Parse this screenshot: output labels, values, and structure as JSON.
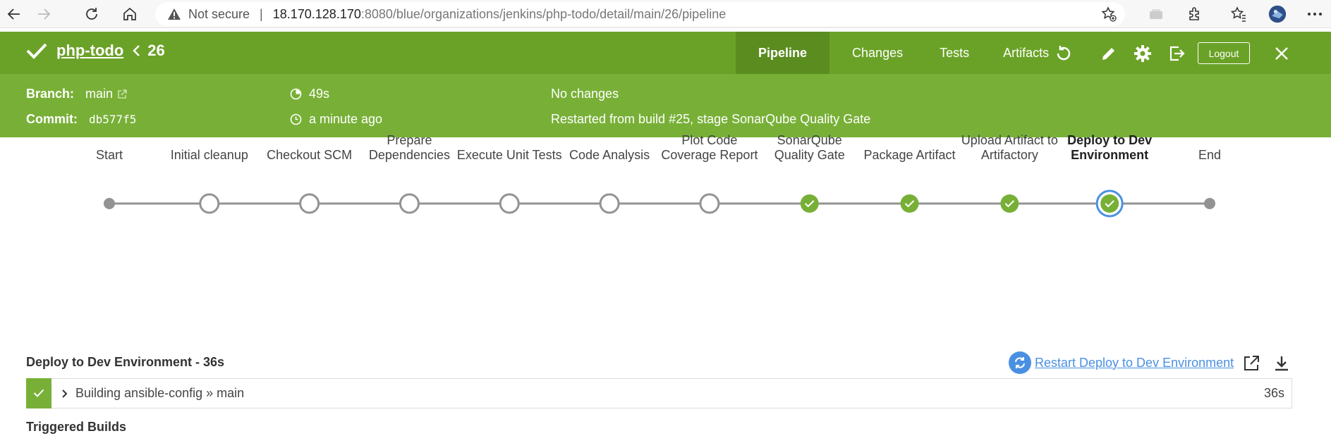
{
  "browser": {
    "not_secure": "Not secure",
    "url_host": "18.170.128.170",
    "url_path": ":8080/blue/organizations/jenkins/php-todo/detail/main/26/pipeline"
  },
  "header": {
    "job_name": "php-todo",
    "run_number": "26",
    "tabs": [
      {
        "label": "Pipeline",
        "active": true
      },
      {
        "label": "Changes",
        "active": false
      },
      {
        "label": "Tests",
        "active": false
      },
      {
        "label": "Artifacts",
        "active": false
      }
    ],
    "logout_label": "Logout"
  },
  "summary": {
    "branch_label": "Branch:",
    "branch_value": "main",
    "commit_label": "Commit:",
    "commit_value": "db577f5",
    "duration": "49s",
    "time_ago": "a minute ago",
    "changes": "No changes",
    "cause": "Restarted from build #25, stage SonarQube Quality Gate"
  },
  "pipeline": {
    "stages": [
      {
        "name": "Start",
        "state": "terminal",
        "selected": false
      },
      {
        "name": "Initial cleanup",
        "state": "not-built",
        "selected": false
      },
      {
        "name": "Checkout SCM",
        "state": "not-built",
        "selected": false
      },
      {
        "name": "Prepare Dependencies",
        "state": "not-built",
        "selected": false
      },
      {
        "name": "Execute Unit Tests",
        "state": "not-built",
        "selected": false
      },
      {
        "name": "Code Analysis",
        "state": "not-built",
        "selected": false
      },
      {
        "name": "Plot Code Coverage Report",
        "state": "not-built",
        "selected": false
      },
      {
        "name": "SonarQube Quality Gate",
        "state": "success",
        "selected": false
      },
      {
        "name": "Package Artifact",
        "state": "success",
        "selected": false
      },
      {
        "name": "Upload Artifact to Artifactory",
        "state": "success",
        "selected": false
      },
      {
        "name": "Deploy to Dev Environment",
        "state": "success",
        "selected": true
      },
      {
        "name": "End",
        "state": "terminal",
        "selected": false
      }
    ]
  },
  "step_panel": {
    "title": "Deploy to Dev Environment - 36s",
    "restart_label": "Restart Deploy to Dev Environment",
    "log_rows": [
      {
        "text": "Building ansible-config » main",
        "duration": "36s",
        "status": "success"
      }
    ],
    "triggered_builds_label": "Triggered Builds"
  },
  "colors": {
    "header_green": "#6aa227",
    "subheader_green": "#78b037",
    "success_green": "#78b037",
    "not_built_gray": "#949393",
    "selected_blue": "#4a90e2",
    "link_blue": "#4a90e2"
  },
  "icons": [
    "back-arrow-icon",
    "forward-arrow-icon",
    "reload-icon",
    "home-icon",
    "warning-icon",
    "favorite-add-icon",
    "extension-icon",
    "favorites-icon",
    "profile-icon",
    "more-icon",
    "check-icon",
    "chevron-left-icon",
    "replay-icon",
    "edit-icon",
    "gear-icon",
    "exit-icon",
    "close-icon",
    "external-link-icon",
    "timer-icon",
    "clock-icon",
    "restart-icon",
    "open-new-icon",
    "download-icon",
    "chevron-right-icon"
  ]
}
